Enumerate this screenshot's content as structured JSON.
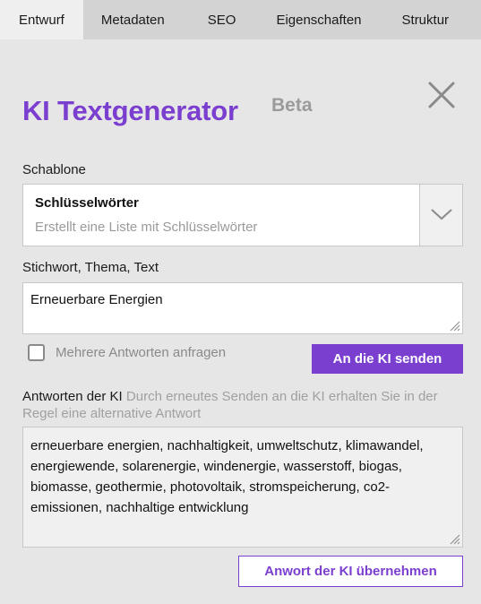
{
  "tabs": [
    {
      "label": "Entwurf",
      "active": true
    },
    {
      "label": "Metadaten",
      "active": false
    },
    {
      "label": "SEO",
      "active": false
    },
    {
      "label": "Eigenschaften",
      "active": false
    },
    {
      "label": "Struktur",
      "active": false
    }
  ],
  "dialog": {
    "title": "KI Textgenerator",
    "badge": "Beta",
    "close_icon": "close-icon"
  },
  "template": {
    "label": "Schablone",
    "selected_title": "Schlüsselwörter",
    "selected_description": "Erstellt eine Liste mit Schlüsselwörter",
    "dropdown_icon": "chevron-down-icon"
  },
  "prompt": {
    "label": "Stichwort, Thema, Text",
    "value": "Erneuerbare Energien"
  },
  "options": {
    "multiple_label": "Mehrere Antworten anfragen",
    "multiple_checked": false
  },
  "send_button": "An die KI senden",
  "response": {
    "label": "Antworten der KI",
    "hint": "Durch erneutes Senden an die KI erhalten Sie in der Regel eine alternative Antwort",
    "value": "erneuerbare energien, nachhaltigkeit, umweltschutz, klimawandel, energiewende, solarenergie, windenergie, wasserstoff, biogas, biomasse, geothermie, photovoltaik, stromspeicherung, co2-emissionen, nachhaltige entwicklung"
  },
  "adopt_button": "Anwort der KI übernehmen",
  "colors": {
    "accent": "#7b3fd0",
    "muted": "#9a9a9a",
    "background": "#e6e6e6"
  }
}
